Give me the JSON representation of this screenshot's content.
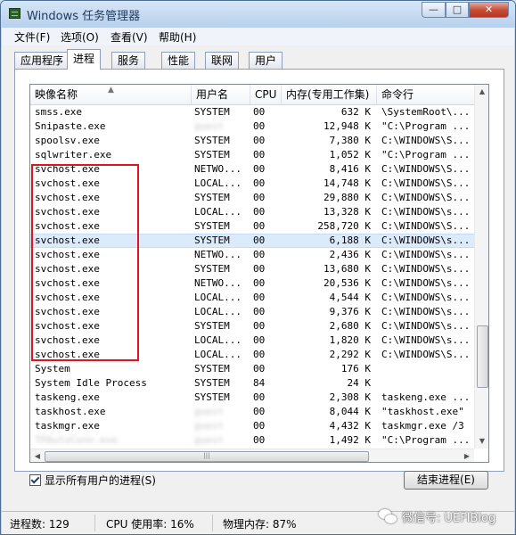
{
  "window": {
    "title": "Windows 任务管理器",
    "controls": {
      "minimize": "—",
      "maximize": "□",
      "close": "✕"
    }
  },
  "menu": [
    "文件(F)",
    "选项(O)",
    "查看(V)",
    "帮助(H)"
  ],
  "tabs": [
    "应用程序",
    "进程",
    "服务",
    "性能",
    "联网",
    "用户"
  ],
  "active_tab": "进程",
  "columns": [
    "映像名称",
    "用户名",
    "CPU",
    "内存(专用工作集)",
    "命令行"
  ],
  "processes": [
    {
      "name": "smss.exe",
      "user": "SYSTEM",
      "cpu": "00",
      "mem": "632 K",
      "cmd": "\\SystemRoot\\..."
    },
    {
      "name": "Snipaste.exe",
      "user": "",
      "cpu": "00",
      "mem": "12,948 K",
      "cmd": "\"C:\\Program ..."
    },
    {
      "name": "spoolsv.exe",
      "user": "SYSTEM",
      "cpu": "00",
      "mem": "7,380 K",
      "cmd": "C:\\WINDOWS\\S..."
    },
    {
      "name": "sqlwriter.exe",
      "user": "SYSTEM",
      "cpu": "00",
      "mem": "1,052 K",
      "cmd": "\"C:\\Program ..."
    },
    {
      "name": "svchost.exe",
      "user": "NETWO...",
      "cpu": "00",
      "mem": "8,416 K",
      "cmd": "C:\\WINDOWS\\S..."
    },
    {
      "name": "svchost.exe",
      "user": "LOCAL...",
      "cpu": "00",
      "mem": "14,748 K",
      "cmd": "C:\\WINDOWS\\S..."
    },
    {
      "name": "svchost.exe",
      "user": "SYSTEM",
      "cpu": "00",
      "mem": "29,880 K",
      "cmd": "C:\\WINDOWS\\S..."
    },
    {
      "name": "svchost.exe",
      "user": "LOCAL...",
      "cpu": "00",
      "mem": "13,328 K",
      "cmd": "C:\\WINDOWS\\s..."
    },
    {
      "name": "svchost.exe",
      "user": "SYSTEM",
      "cpu": "00",
      "mem": "258,720 K",
      "cmd": "C:\\WINDOWS\\S..."
    },
    {
      "name": "svchost.exe",
      "user": "SYSTEM",
      "cpu": "00",
      "mem": "6,188 K",
      "cmd": "C:\\WINDOWS\\s...",
      "selected": true
    },
    {
      "name": "svchost.exe",
      "user": "NETWO...",
      "cpu": "00",
      "mem": "2,436 K",
      "cmd": "C:\\WINDOWS\\s..."
    },
    {
      "name": "svchost.exe",
      "user": "SYSTEM",
      "cpu": "00",
      "mem": "13,680 K",
      "cmd": "C:\\WINDOWS\\s..."
    },
    {
      "name": "svchost.exe",
      "user": "NETWO...",
      "cpu": "00",
      "mem": "20,536 K",
      "cmd": "C:\\WINDOWS\\s..."
    },
    {
      "name": "svchost.exe",
      "user": "LOCAL...",
      "cpu": "00",
      "mem": "4,544 K",
      "cmd": "C:\\WINDOWS\\s..."
    },
    {
      "name": "svchost.exe",
      "user": "LOCAL...",
      "cpu": "00",
      "mem": "9,376 K",
      "cmd": "C:\\WINDOWS\\s..."
    },
    {
      "name": "svchost.exe",
      "user": "SYSTEM",
      "cpu": "00",
      "mem": "2,680 K",
      "cmd": "C:\\WINDOWS\\s..."
    },
    {
      "name": "svchost.exe",
      "user": "LOCAL...",
      "cpu": "00",
      "mem": "1,820 K",
      "cmd": "C:\\WINDOWS\\s..."
    },
    {
      "name": "svchost.exe",
      "user": "LOCAL...",
      "cpu": "00",
      "mem": "2,292 K",
      "cmd": "C:\\WINDOWS\\S..."
    },
    {
      "name": "System",
      "user": "SYSTEM",
      "cpu": "00",
      "mem": "176 K",
      "cmd": ""
    },
    {
      "name": "System Idle Process",
      "user": "SYSTEM",
      "cpu": "84",
      "mem": "24 K",
      "cmd": ""
    },
    {
      "name": "taskeng.exe",
      "user": "SYSTEM",
      "cpu": "00",
      "mem": "2,308 K",
      "cmd": "taskeng.exe ..."
    },
    {
      "name": "taskhost.exe",
      "user": "",
      "cpu": "00",
      "mem": "8,044 K",
      "cmd": "\"taskhost.exe\""
    },
    {
      "name": "taskmgr.exe",
      "user": "",
      "cpu": "00",
      "mem": "4,432 K",
      "cmd": "taskmgr.exe /3"
    },
    {
      "name": "",
      "user": "",
      "cpu": "00",
      "mem": "1,492 K",
      "cmd": "\"C:\\Program ..."
    }
  ],
  "blurred_user_placeholder": "guest",
  "blurred_name_placeholder": "TPAutoConn.exe",
  "show_all_users_label": "显示所有用户的进程(S)",
  "show_all_users_checked": true,
  "end_process_label": "结束进程(E)",
  "status": {
    "processes": "进程数: 129",
    "cpu": "CPU 使用率: 16%",
    "memory": "物理内存: 87%"
  },
  "watermark": "微信号: UEFIBlog",
  "colors": {
    "highlight_box": "#e0141e",
    "selected_row": "#dcebfc"
  }
}
